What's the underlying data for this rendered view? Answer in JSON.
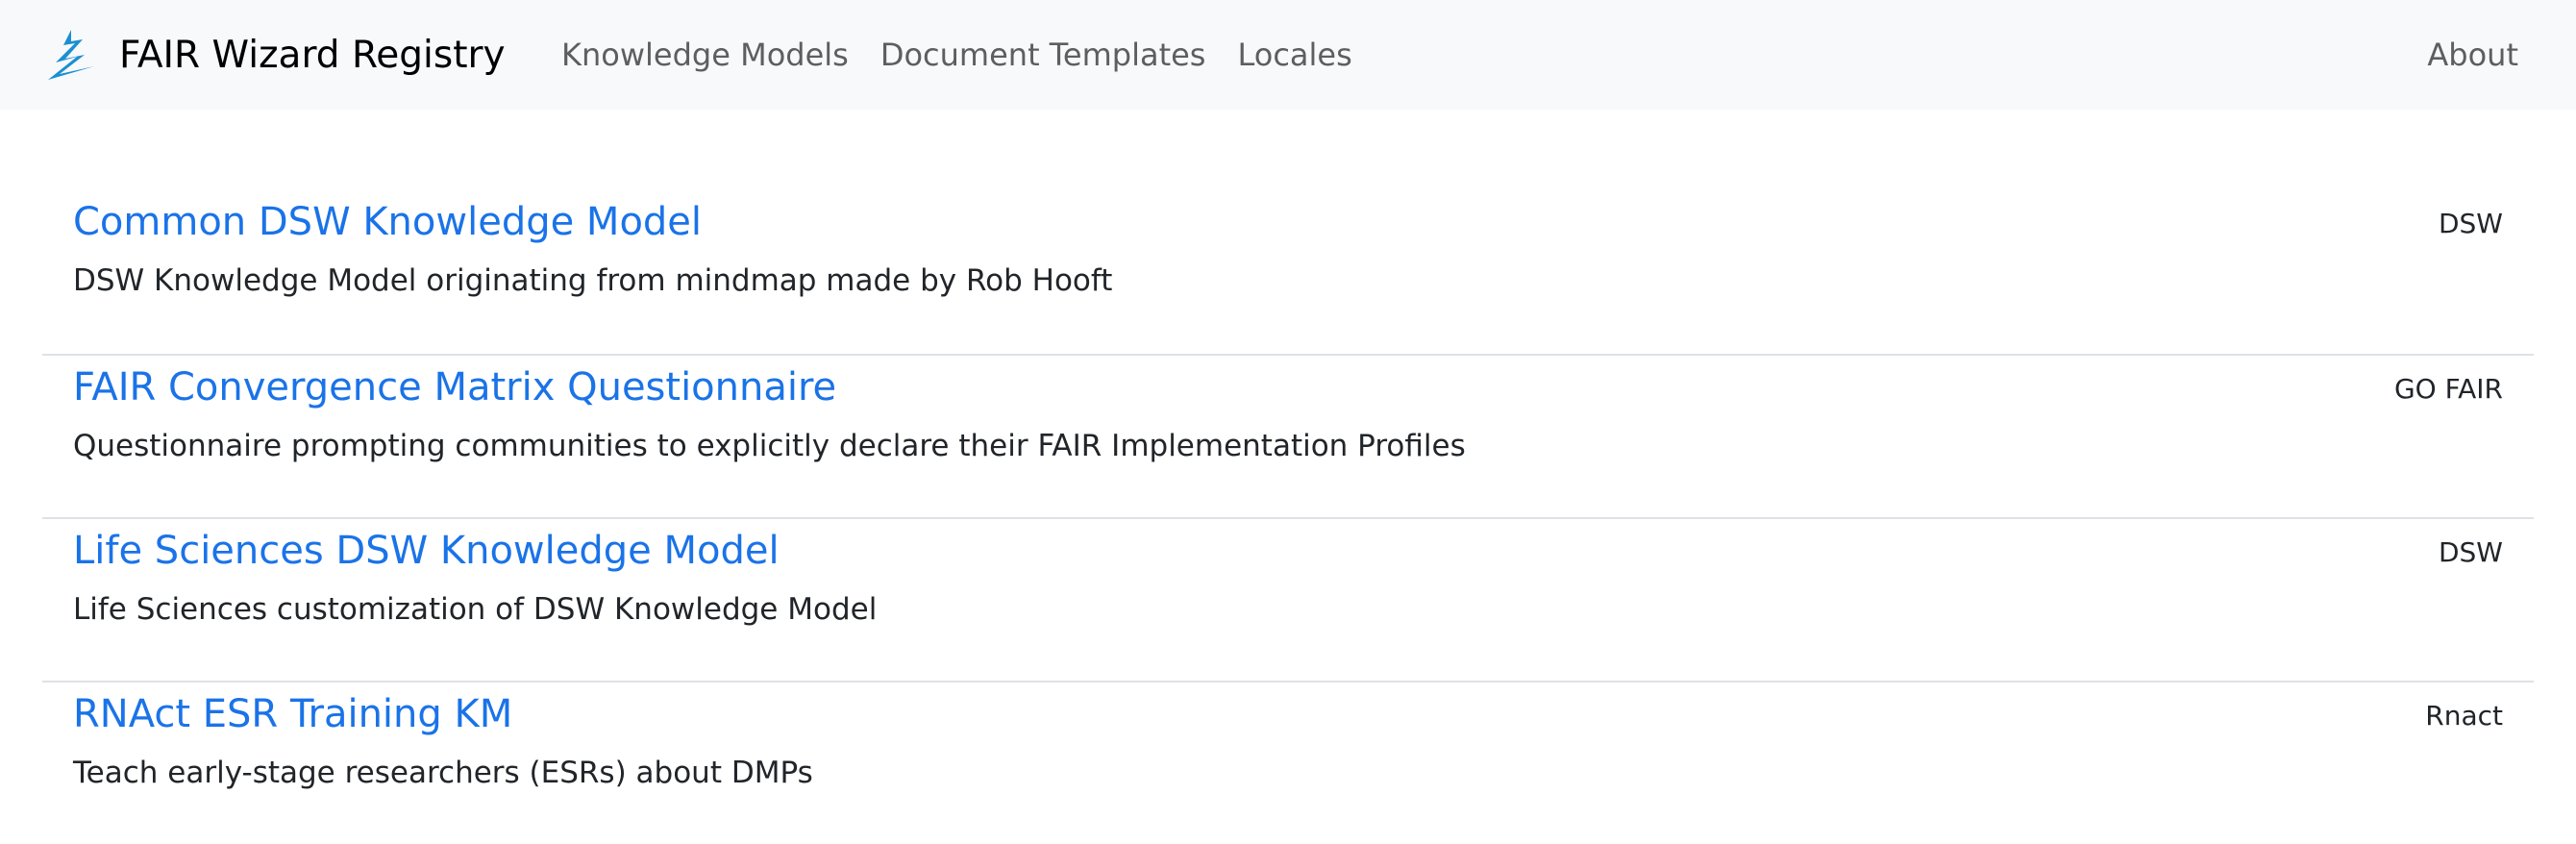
{
  "navbar": {
    "brand_title": "FAIR Wizard Registry",
    "links": [
      {
        "label": "Knowledge Models"
      },
      {
        "label": "Document Templates"
      },
      {
        "label": "Locales"
      }
    ],
    "about_label": "About"
  },
  "colors": {
    "accent": "#1a73e8",
    "navbar_bg": "#f8f9fa",
    "logo": "#1b8fd1"
  },
  "knowledge_models": [
    {
      "title": "Common DSW Knowledge Model",
      "description": "DSW Knowledge Model originating from mindmap made by Rob Hooft",
      "organization": "DSW"
    },
    {
      "title": "FAIR Convergence Matrix Questionnaire",
      "description": "Questionnaire prompting communities to explicitly declare their FAIR Implementation Profiles",
      "organization": "GO FAIR"
    },
    {
      "title": "Life Sciences DSW Knowledge Model",
      "description": "Life Sciences customization of DSW Knowledge Model",
      "organization": "DSW"
    },
    {
      "title": "RNAct ESR Training KM",
      "description": "Teach early-stage researchers (ESRs) about DMPs",
      "organization": "Rnact"
    }
  ]
}
